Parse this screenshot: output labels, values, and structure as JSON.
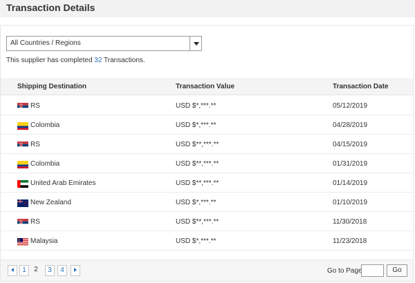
{
  "header": {
    "title": "Transaction Details"
  },
  "filter": {
    "selected": "All Countries / Regions"
  },
  "summary": {
    "prefix": "This supplier has completed",
    "count": "32",
    "suffix": "Transactions."
  },
  "table": {
    "columns": [
      "Shipping Destination",
      "Transaction Value",
      "Transaction Date"
    ],
    "rows": [
      {
        "flag": "serbia-flag",
        "destination": "RS",
        "value": "USD $*,***.**",
        "date": "05/12/2019"
      },
      {
        "flag": "colombia-flag",
        "destination": "Colombia",
        "value": "USD $*,***.**",
        "date": "04/28/2019"
      },
      {
        "flag": "serbia-flag",
        "destination": "RS",
        "value": "USD $**,***.**",
        "date": "04/15/2019"
      },
      {
        "flag": "colombia-flag",
        "destination": "Colombia",
        "value": "USD $**,***.**",
        "date": "01/31/2019"
      },
      {
        "flag": "uae-flag",
        "destination": "United Arab Emirates",
        "value": "USD $**,***.**",
        "date": "01/14/2019"
      },
      {
        "flag": "new-zealand-flag",
        "destination": "New Zealand",
        "value": "USD $*,***.**",
        "date": "01/10/2019"
      },
      {
        "flag": "serbia-flag",
        "destination": "RS",
        "value": "USD $**,***.**",
        "date": "11/30/2018"
      },
      {
        "flag": "malaysia-flag",
        "destination": "Malaysia",
        "value": "USD $*,***.**",
        "date": "11/23/2018"
      }
    ]
  },
  "pagination": {
    "pages": [
      "1",
      "2",
      "3",
      "4"
    ],
    "current": "2",
    "goto_label": "Go to Page",
    "goto_value": "",
    "go_button": "Go"
  },
  "colors": {
    "link": "#2a6ebb",
    "header_bg": "#f2f2f2"
  }
}
